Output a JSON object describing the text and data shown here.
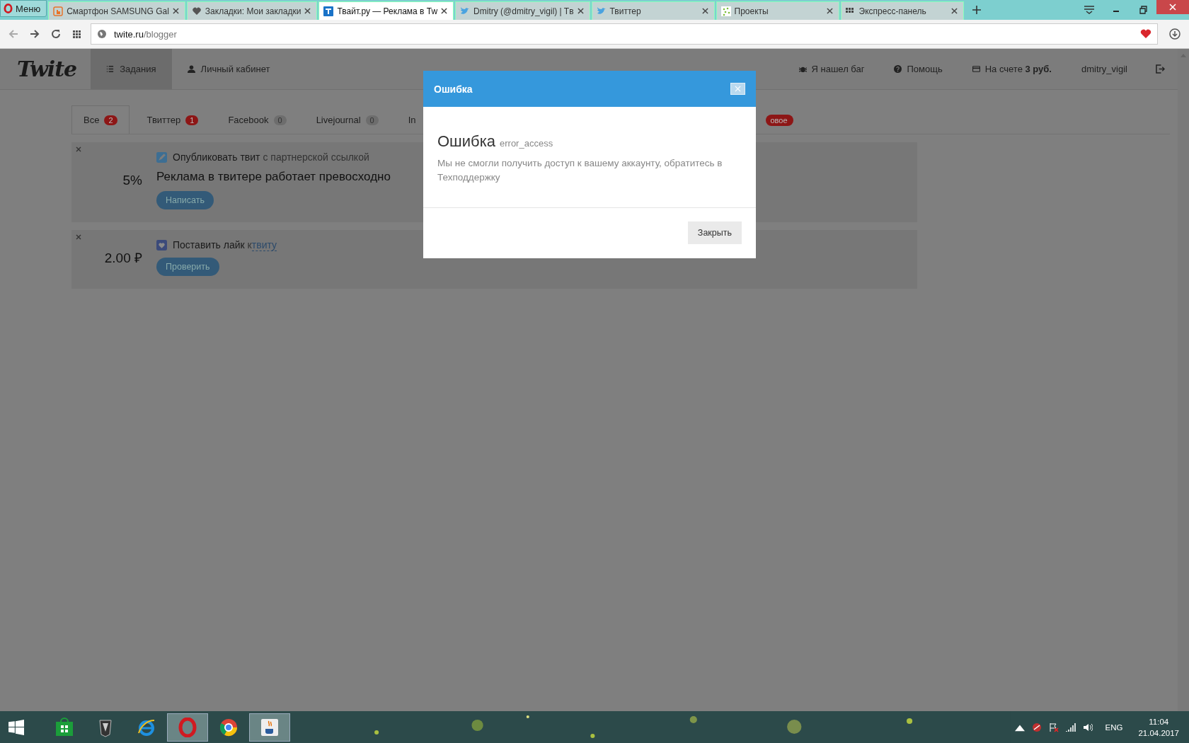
{
  "browser": {
    "menu": "Меню",
    "tabs": [
      {
        "label": "Смартфон SAMSUNG Gal",
        "kind": "hand",
        "selected": false
      },
      {
        "label": "Закладки: Мои закладки",
        "kind": "heart",
        "selected": false
      },
      {
        "label": "Твайт.ру — Реклама в Tw",
        "kind": "site",
        "selected": true
      },
      {
        "label": "Dmitry (@dmitry_vigil) | Tв",
        "kind": "bird",
        "selected": false
      },
      {
        "label": "Твиттер",
        "kind": "bird",
        "selected": false
      },
      {
        "label": "Проекты",
        "kind": "dots",
        "selected": false
      },
      {
        "label": "Экспресс-панель",
        "kind": "grid",
        "selected": false
      }
    ],
    "address": {
      "host": "twite.ru",
      "path": "/blogger"
    }
  },
  "site": {
    "logo": "Twite",
    "nav": [
      {
        "label": "Задания",
        "kind": "list",
        "selected": true
      },
      {
        "label": "Личный кабинет",
        "kind": "user",
        "selected": false
      }
    ],
    "links": [
      {
        "label": "Я нашел баг",
        "kind": "bug"
      },
      {
        "label": "Помощь",
        "kind": "help"
      },
      {
        "label": "На счете **3 руб.**",
        "kind": "card"
      }
    ],
    "user": "dmitry_vigil"
  },
  "filters": [
    {
      "label": "Все",
      "count": "2",
      "highlight": true,
      "selected": true
    },
    {
      "label": "Твиттер",
      "count": "1",
      "highlight": true,
      "selected": false
    },
    {
      "label": "Facebook",
      "count": "0",
      "highlight": false,
      "selected": false
    },
    {
      "label": "Livejournal",
      "count": "0",
      "highlight": false,
      "selected": false
    },
    {
      "label": "In",
      "selected": false
    }
  ],
  "new_badge": "овое",
  "tasks": [
    {
      "kind": "tweet",
      "title": "Опубликовать твит",
      "suffix": "с партнерской ссылкой",
      "reward": "5%",
      "text": "Реклама в твитере работает превосходно",
      "action": "Написать"
    },
    {
      "kind": "like",
      "title": "Поставить лайк",
      "suffix": "к",
      "link": "твиту",
      "reward": "2.00 ₽",
      "action": "Проверить"
    }
  ],
  "dialog": {
    "title": "Ошибка",
    "heading": "Ошибка",
    "code": "error_access",
    "message": "Мы не смогли получить доступ к вашему аккаунту, обратитесь в Техподдержку",
    "button": "Закрыть"
  },
  "taskbar": {
    "apps": [
      {
        "kind": "store",
        "selected": false
      },
      {
        "kind": "tank",
        "selected": false
      },
      {
        "kind": "ie",
        "selected": false
      },
      {
        "kind": "opera",
        "selected": true
      },
      {
        "kind": "chrome",
        "selected": false
      },
      {
        "kind": "java",
        "selected": true
      }
    ],
    "language": "ENG",
    "time": "11:04",
    "date": "21.04.2017"
  }
}
